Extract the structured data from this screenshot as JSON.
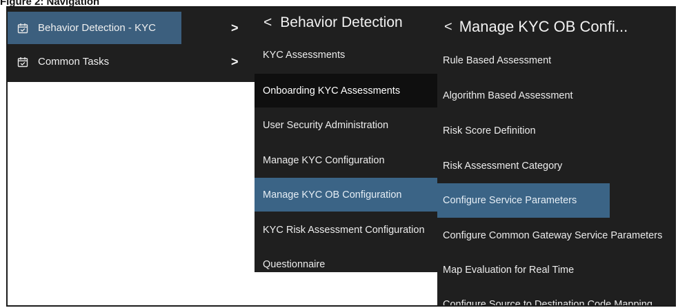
{
  "caption": "Figure 2: Navigation",
  "panel1": {
    "items": [
      {
        "label": "Behavior Detection - KYC",
        "chevron": ">"
      },
      {
        "label": "Common Tasks",
        "chevron": ">"
      }
    ]
  },
  "panel2": {
    "back": "<",
    "title": "Behavior Detection",
    "items": [
      {
        "label": "KYC Assessments"
      },
      {
        "label": "Onboarding KYC Assessments"
      },
      {
        "label": "User Security Administration"
      },
      {
        "label": "Manage KYC Configuration"
      },
      {
        "label": "Manage KYC OB Configuration"
      },
      {
        "label": "KYC Risk Assessment Configuration"
      },
      {
        "label": "Questionnaire"
      }
    ]
  },
  "panel3": {
    "back": "<",
    "title": "Manage KYC OB Confi...",
    "items": [
      {
        "label": "Rule Based Assessment"
      },
      {
        "label": "Algorithm Based Assessment"
      },
      {
        "label": "Risk Score Definition"
      },
      {
        "label": "Risk Assessment Category"
      },
      {
        "label": "Configure Service Parameters"
      },
      {
        "label": "Configure Common Gateway Service Parameters"
      },
      {
        "label": "Map Evaluation for Real Time"
      },
      {
        "label": "Configure Source to Destination Code Mapping"
      }
    ]
  },
  "colors": {
    "menu_bg": "#1f1f1f",
    "selected_bg": "#3b6486",
    "hover_dark_bg": "#0f0f0f"
  },
  "icons": {
    "menu_item_icon": "calendar-check-icon",
    "back": "chevron-left-icon",
    "submenu": "chevron-right-icon"
  }
}
